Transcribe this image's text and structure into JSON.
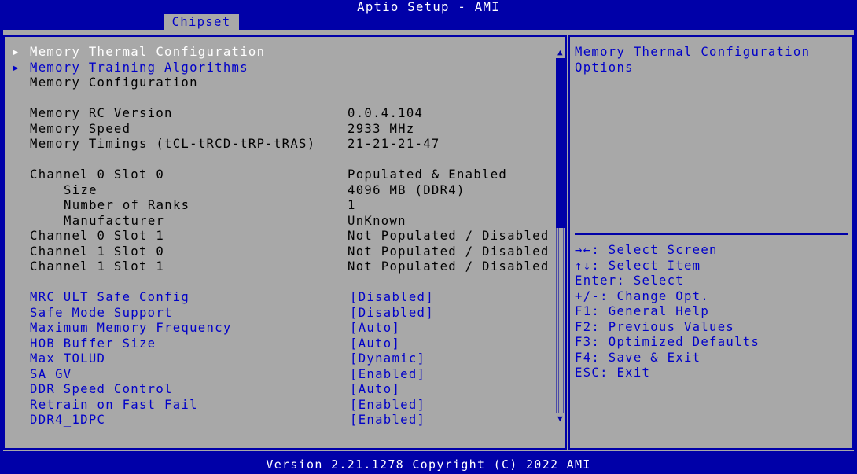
{
  "window": {
    "title": "Aptio Setup - AMI"
  },
  "tabs": [
    {
      "label": "Chipset"
    }
  ],
  "menu": {
    "submenus": [
      {
        "label": "Memory Thermal Configuration"
      },
      {
        "label": "Memory Training Algorithms"
      }
    ],
    "section_title": "Memory Configuration",
    "info": [
      {
        "label": "Memory RC Version",
        "value": "0.0.4.104"
      },
      {
        "label": "Memory Speed",
        "value": "2933 MHz"
      },
      {
        "label": "Memory Timings (tCL-tRCD-tRP-tRAS)",
        "value": "21-21-21-47"
      }
    ],
    "slots": [
      {
        "label": "Channel 0 Slot 0",
        "value": "Populated & Enabled"
      },
      {
        "label": "Size",
        "value": "4096 MB (DDR4)"
      },
      {
        "label": "Number of Ranks",
        "value": "1"
      },
      {
        "label": "Manufacturer",
        "value": "UnKnown"
      },
      {
        "label": "Channel 0 Slot 1",
        "value": "Not Populated / Disabled"
      },
      {
        "label": "Channel 1 Slot 0",
        "value": "Not Populated / Disabled"
      },
      {
        "label": "Channel 1 Slot 1",
        "value": "Not Populated / Disabled"
      }
    ],
    "options": [
      {
        "label": "MRC ULT Safe Config",
        "value": "[Disabled]"
      },
      {
        "label": "Safe Mode Support",
        "value": "[Disabled]"
      },
      {
        "label": "Maximum Memory Frequency",
        "value": "[Auto]"
      },
      {
        "label": "HOB Buffer Size",
        "value": "[Auto]"
      },
      {
        "label": "Max TOLUD",
        "value": "[Dynamic]"
      },
      {
        "label": "SA GV",
        "value": "[Enabled]"
      },
      {
        "label": "DDR Speed Control",
        "value": "[Auto]"
      },
      {
        "label": "Retrain on Fast Fail",
        "value": "[Enabled]"
      },
      {
        "label": "DDR4_1DPC",
        "value": "[Enabled]"
      }
    ]
  },
  "help": {
    "lines": [
      "Memory Thermal Configuration",
      "Options"
    ]
  },
  "keys": [
    "→←: Select Screen",
    "↑↓: Select Item",
    "Enter: Select",
    "+/-: Change Opt.",
    "F1: General Help",
    "F2: Previous Values",
    "F3: Optimized Defaults",
    "F4: Save & Exit",
    "ESC: Exit"
  ],
  "footer": {
    "text": "Version 2.21.1278 Copyright (C) 2022 AMI"
  },
  "icons": {
    "submenu": "triangle-right-icon",
    "scroll_up": "triangle-up-icon",
    "scroll_down": "triangle-down-icon"
  },
  "colors": {
    "background": "#0000a8",
    "panel": "#a8a8a8",
    "selectable": "#0000c8",
    "highlight": "#ffffff"
  }
}
